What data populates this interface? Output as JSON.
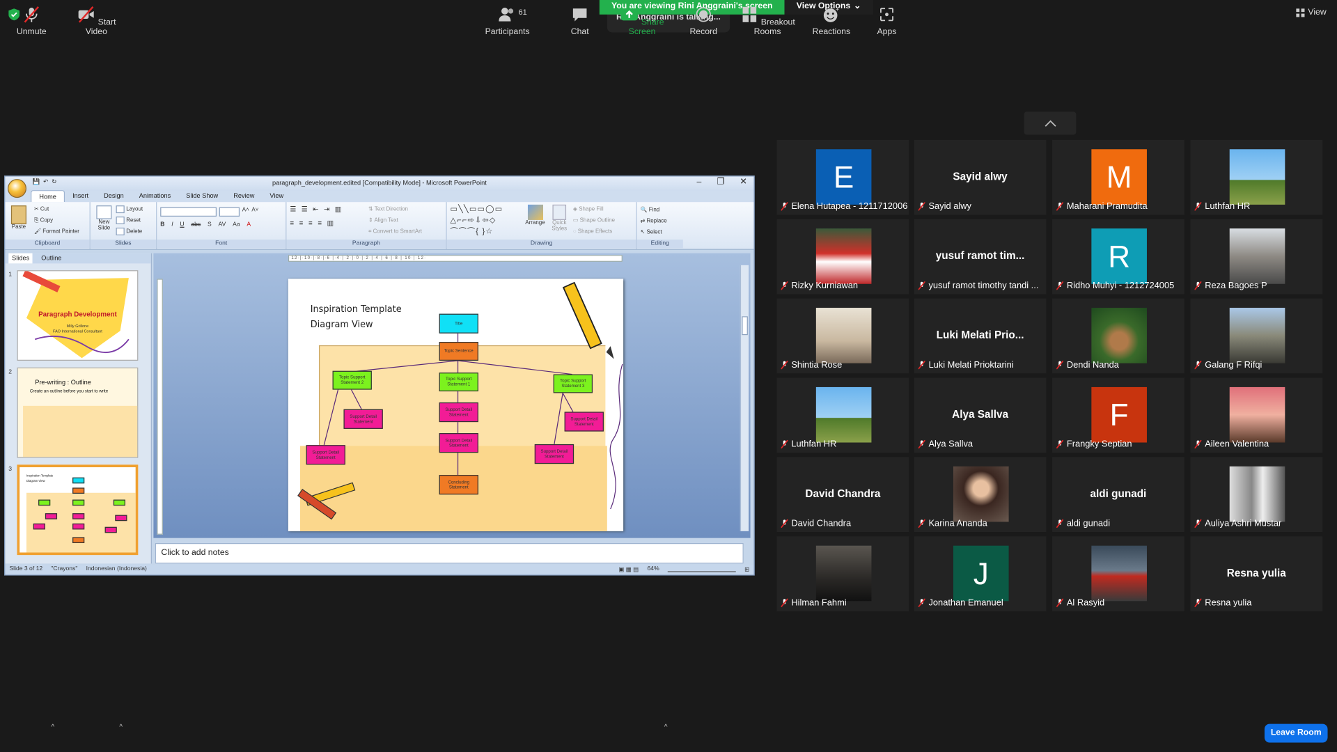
{
  "banner": {
    "viewing": "You are viewing Rini Anggraini's screen",
    "view_options": "View Options",
    "talking": "Rini Anggraini is talking..."
  },
  "view_button": "View",
  "ppt": {
    "title": "paragraph_development.edited [Compatibility Mode] - Microsoft PowerPoint",
    "tabs": [
      "Home",
      "Insert",
      "Design",
      "Animations",
      "Slide Show",
      "Review",
      "View"
    ],
    "clipboard": {
      "paste": "Paste",
      "cut": "Cut",
      "copy": "Copy",
      "format_painter": "Format Painter",
      "label": "Clipboard"
    },
    "slides_grp": {
      "new_slide": "New Slide",
      "layout": "Layout",
      "reset": "Reset",
      "delete": "Delete",
      "label": "Slides"
    },
    "font_label": "Font",
    "paragraph": {
      "text_direction": "Text Direction",
      "align_text": "Align Text",
      "convert": "Convert to SmartArt",
      "label": "Paragraph"
    },
    "drawing": {
      "arrange": "Arrange",
      "quick_styles": "Quick Styles",
      "shape_fill": "Shape Fill",
      "shape_outline": "Shape Outline",
      "shape_effects": "Shape Effects",
      "label": "Drawing"
    },
    "editing": {
      "find": "Find",
      "replace": "Replace",
      "select": "Select",
      "label": "Editing"
    },
    "pane_tabs": [
      "Slides",
      "Outline"
    ],
    "thumb1": {
      "title": "Paragraph Development",
      "author": "Milly Grillone",
      "org": "FAO International Consultant"
    },
    "thumb2": {
      "title": "Pre-writing : Outline",
      "bullet": "Create an outline before you start to write"
    },
    "thumb3": {
      "title": "Inspiration Template",
      "subtitle": "Diagram View"
    },
    "slide": {
      "title1": "Inspiration Template",
      "title2": "Diagram View",
      "title_box": "Title",
      "topic": "Topic Sentence",
      "support2": "Topic Support Statement 2",
      "support1": "Topic Support Statement 1",
      "support3": "Topic Support Statement 3",
      "detail": "Support Detail Statement",
      "concluding": "Concluding Statement"
    },
    "notes": "Click to add notes",
    "status": {
      "slide": "Slide 3 of 12",
      "theme": "\"Crayons\"",
      "lang": "Indonesian (Indonesia)",
      "zoom": "64%"
    }
  },
  "participants": [
    {
      "name": "Elena Hutapea - 1211712006",
      "type": "initial",
      "initial": "E",
      "color": "#0a5fb4"
    },
    {
      "name": "Sayid alwy",
      "type": "text",
      "display": "Sayid alwy"
    },
    {
      "name": "Maharani Pramudita",
      "type": "initial",
      "initial": "M",
      "color": "#f06b0e"
    },
    {
      "name": "Luthfan HR",
      "type": "photo",
      "photo": "sky"
    },
    {
      "name": "Rizky Kurniawan",
      "type": "photo",
      "photo": "red"
    },
    {
      "name": "yusuf ramot timothy tandi ...",
      "type": "text",
      "display": "yusuf ramot tim..."
    },
    {
      "name": "Ridho Muhyi - 1212724005",
      "type": "initial",
      "initial": "R",
      "color": "#0e9db5"
    },
    {
      "name": "Reza Bagoes P",
      "type": "photo",
      "photo": "street"
    },
    {
      "name": "Shintia Rose",
      "type": "photo",
      "photo": "beige"
    },
    {
      "name": "Luki Melati Prioktarini",
      "type": "text",
      "display": "Luki Melati Prio..."
    },
    {
      "name": "Dendi Nanda",
      "type": "photo",
      "photo": "deer"
    },
    {
      "name": "Galang F Rifqi",
      "type": "photo",
      "photo": "group"
    },
    {
      "name": "Luthfan HR",
      "type": "photo",
      "photo": "sky"
    },
    {
      "name": "Alya Sallva",
      "type": "text",
      "display": "Alya Sallva"
    },
    {
      "name": "Frangky Septian",
      "type": "initial",
      "initial": "F",
      "color": "#c8340e"
    },
    {
      "name": "Aileen Valentina",
      "type": "photo",
      "photo": "pink"
    },
    {
      "name": "David Chandra",
      "type": "text",
      "display": "David Chandra"
    },
    {
      "name": "Karina Ananda",
      "type": "photo",
      "photo": "woman"
    },
    {
      "name": "aldi gunadi",
      "type": "text",
      "display": "aldi gunadi"
    },
    {
      "name": "Auliya Ashri Mustar",
      "type": "photo",
      "photo": "bw"
    },
    {
      "name": "Hilman Fahmi",
      "type": "photo",
      "photo": "dark"
    },
    {
      "name": "Jonathan Emanuel",
      "type": "initial",
      "initial": "J",
      "color": "#0b5a45"
    },
    {
      "name": "Al Rasyid",
      "type": "photo",
      "photo": "car"
    },
    {
      "name": "Resna yulia",
      "type": "text",
      "display": "Resna yulia"
    }
  ],
  "toolbar": {
    "unmute": "Unmute",
    "start_video": "Start Video",
    "participants": "Participants",
    "participants_count": "61",
    "chat": "Chat",
    "share": "Share Screen",
    "record": "Record",
    "breakout": "Breakout Rooms",
    "reactions": "Reactions",
    "apps": "Apps",
    "leave": "Leave Room"
  },
  "colors": {
    "share_green": "#23b14d",
    "leave_blue": "#0e71eb"
  }
}
